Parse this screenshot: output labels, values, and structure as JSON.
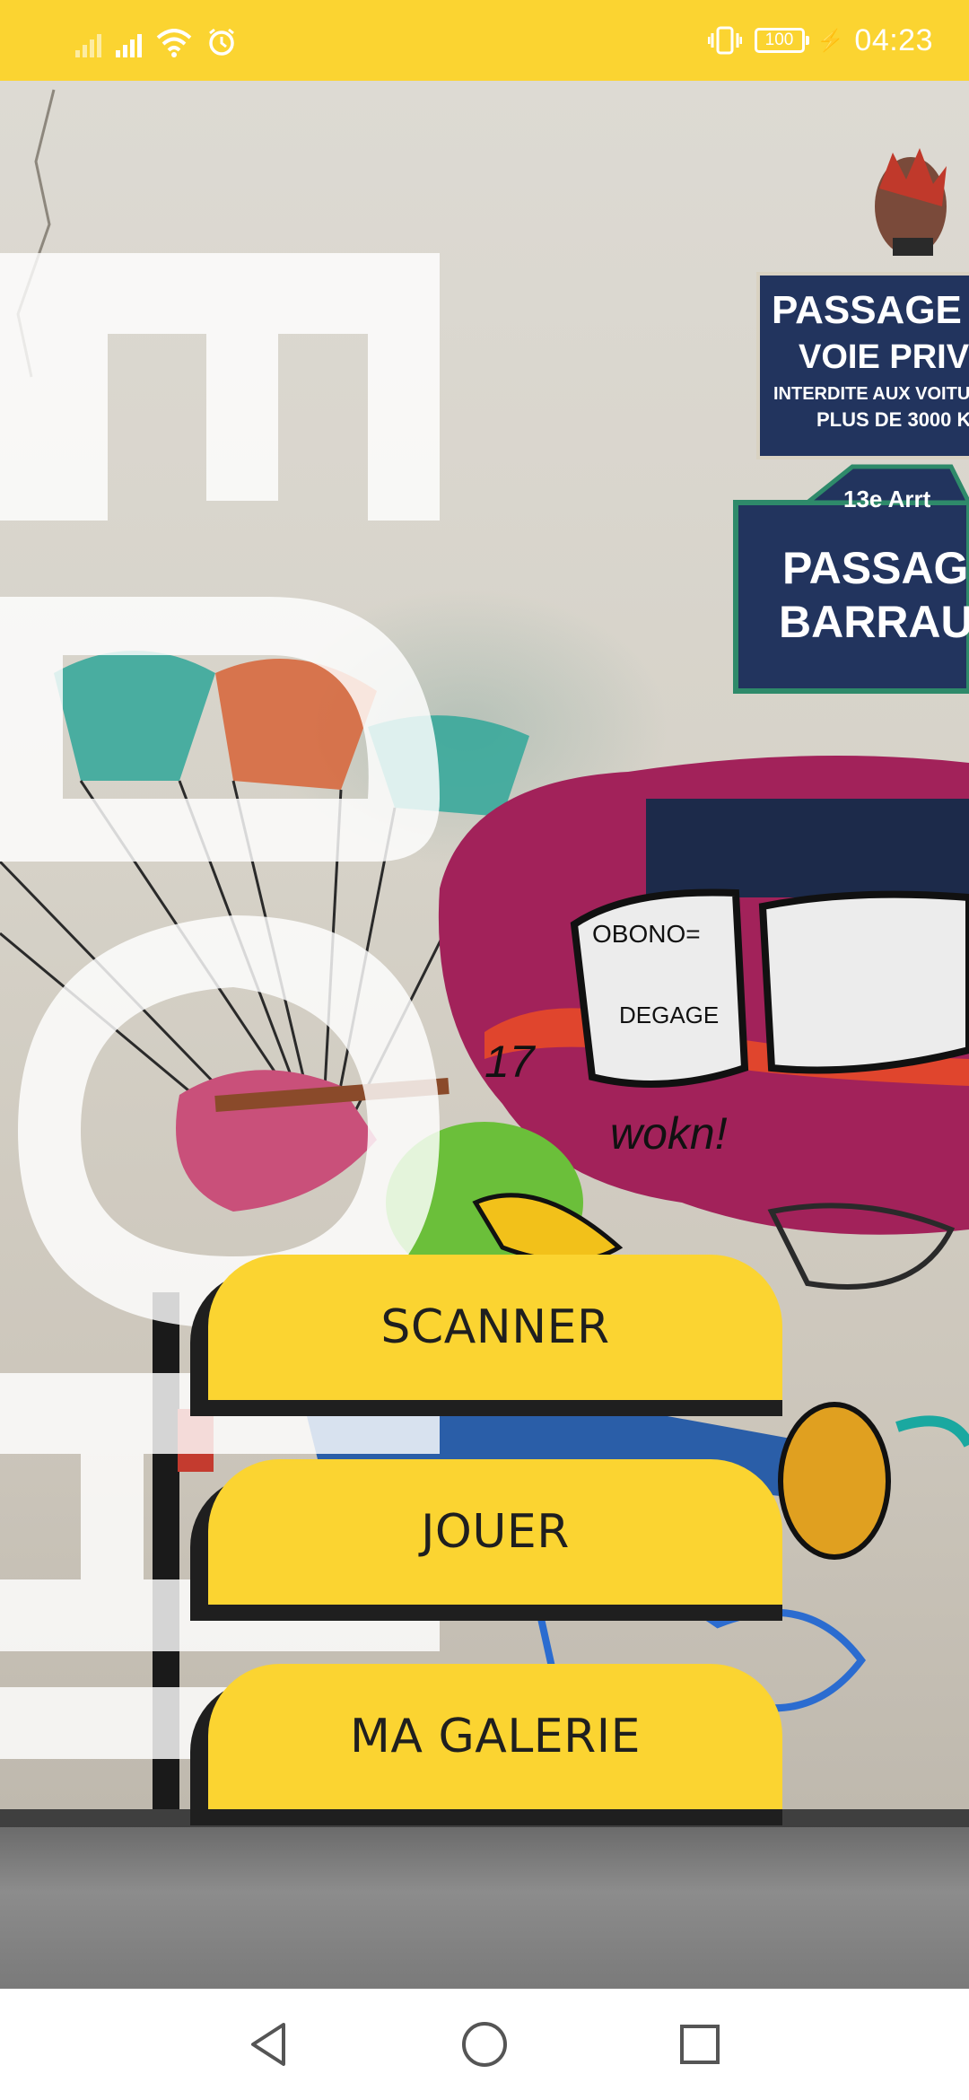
{
  "status_bar": {
    "time": "04:23",
    "battery": "100",
    "icons": [
      "signal-sim1-icon",
      "signal-sim2-icon",
      "wifi-icon",
      "alarm-icon",
      "vibrate-icon",
      "battery-icon",
      "charging-icon"
    ]
  },
  "colors": {
    "accent": "#fbd431",
    "button_shadow": "#1f1f1f",
    "button_text": "#1f1f1f"
  },
  "menu": {
    "buttons": [
      {
        "label": "SCANNER"
      },
      {
        "label": "JOUER"
      },
      {
        "label": "MA GALERIE"
      }
    ]
  },
  "nav_bar": {
    "icons": [
      "back-icon",
      "home-icon",
      "recents-icon"
    ]
  }
}
